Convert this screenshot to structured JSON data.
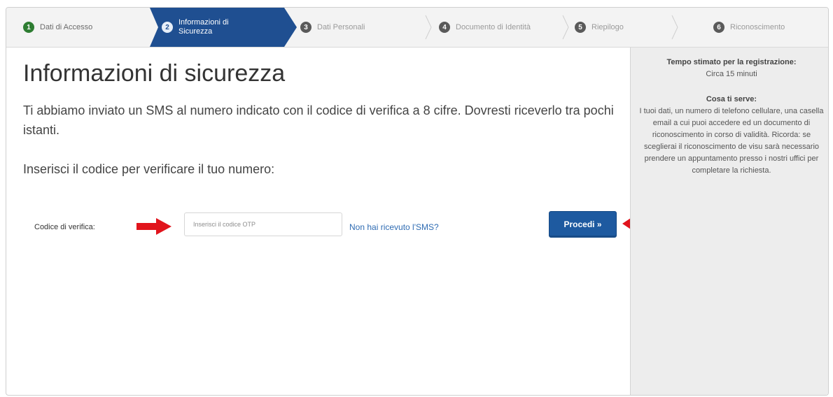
{
  "stepper": {
    "steps": [
      {
        "number": "1",
        "label": "Dati di Accesso",
        "state": "done"
      },
      {
        "number": "2",
        "label": "Informazioni di Sicurezza",
        "state": "active"
      },
      {
        "number": "3",
        "label": "Dati Personali",
        "state": "pending"
      },
      {
        "number": "4",
        "label": "Documento di Identità",
        "state": "pending"
      },
      {
        "number": "5",
        "label": "Riepilogo",
        "state": "pending"
      },
      {
        "number": "6",
        "label": "Riconoscimento",
        "state": "pending"
      }
    ],
    "colors": {
      "active": "#1f4f91",
      "done": "#2e7d32"
    }
  },
  "main": {
    "title": "Informazioni di sicurezza",
    "intro": "Ti abbiamo inviato un SMS al numero indicato con il codice di verifica a 8 cifre. Dovresti riceverlo tra pochi istanti.",
    "prompt": "Inserisci il codice per verificare il tuo numero:",
    "code_label": "Codice di verifica:",
    "otp_placeholder": "Inserisci il codice OTP",
    "resend_link": "Non hai ricevuto l'SMS?",
    "proceed_button": "Procedi »",
    "annotation_arrows": {
      "color": "#e1141c",
      "icons": [
        "arrow-right-icon",
        "arrow-left-icon"
      ]
    }
  },
  "sidebar": {
    "time_heading": "Tempo stimato per la registrazione:",
    "time_value": "Circa 15 minuti",
    "needs_heading": "Cosa ti serve:",
    "needs_text": "I tuoi dati, un numero di telefono cellulare, una casella email a cui puoi accedere ed un documento di riconoscimento in corso di validità. Ricorda: se sceglierai il riconoscimento de visu sarà necessario prendere un appuntamento presso i nostri uffici per completare la richiesta."
  }
}
